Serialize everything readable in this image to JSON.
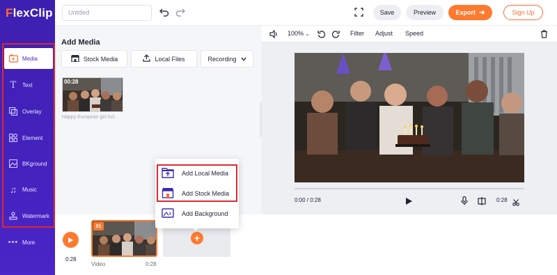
{
  "app": {
    "logo": "FlexClip"
  },
  "sidebar": {
    "items": [
      {
        "label": "Media",
        "icon": "media-icon",
        "active": true
      },
      {
        "label": "Text",
        "icon": "text-icon"
      },
      {
        "label": "Overlay",
        "icon": "overlay-icon"
      },
      {
        "label": "Element",
        "icon": "element-icon"
      },
      {
        "label": "BKground",
        "icon": "background-icon"
      },
      {
        "label": "Music",
        "icon": "music-icon"
      },
      {
        "label": "Watermark",
        "icon": "watermark-icon"
      },
      {
        "label": "More",
        "icon": "more-icon"
      }
    ]
  },
  "topbar": {
    "project_title_placeholder": "Untitled",
    "save_label": "Save",
    "preview_label": "Preview",
    "export_label": "Export",
    "signup_label": "Sign Up"
  },
  "media_panel": {
    "title": "Add Media",
    "buttons": {
      "stock": "Stock Media",
      "local": "Local Files",
      "recording": "Recording"
    },
    "items": [
      {
        "duration": "00:28",
        "name": "Happy European girl hol..."
      }
    ]
  },
  "preview": {
    "zoom": "100%",
    "tools": {
      "filter": "Filter",
      "adjust": "Adjust",
      "speed": "Speed"
    },
    "time_current": "0:00 / 0:28",
    "time_right": "0:28"
  },
  "popup": {
    "items": [
      {
        "label": "Add Local Media",
        "icon": "upload-icon"
      },
      {
        "label": "Add Stock Media",
        "icon": "store-icon"
      },
      {
        "label": "Add Background",
        "icon": "background-fill-icon"
      }
    ]
  },
  "timeline": {
    "duration": "0:28",
    "clip": {
      "index": "01",
      "label": "Video",
      "duration": "0:28"
    }
  },
  "colors": {
    "sidebar": "#4a25c7",
    "accent": "#ff6b35",
    "highlight": "#e0272e"
  }
}
